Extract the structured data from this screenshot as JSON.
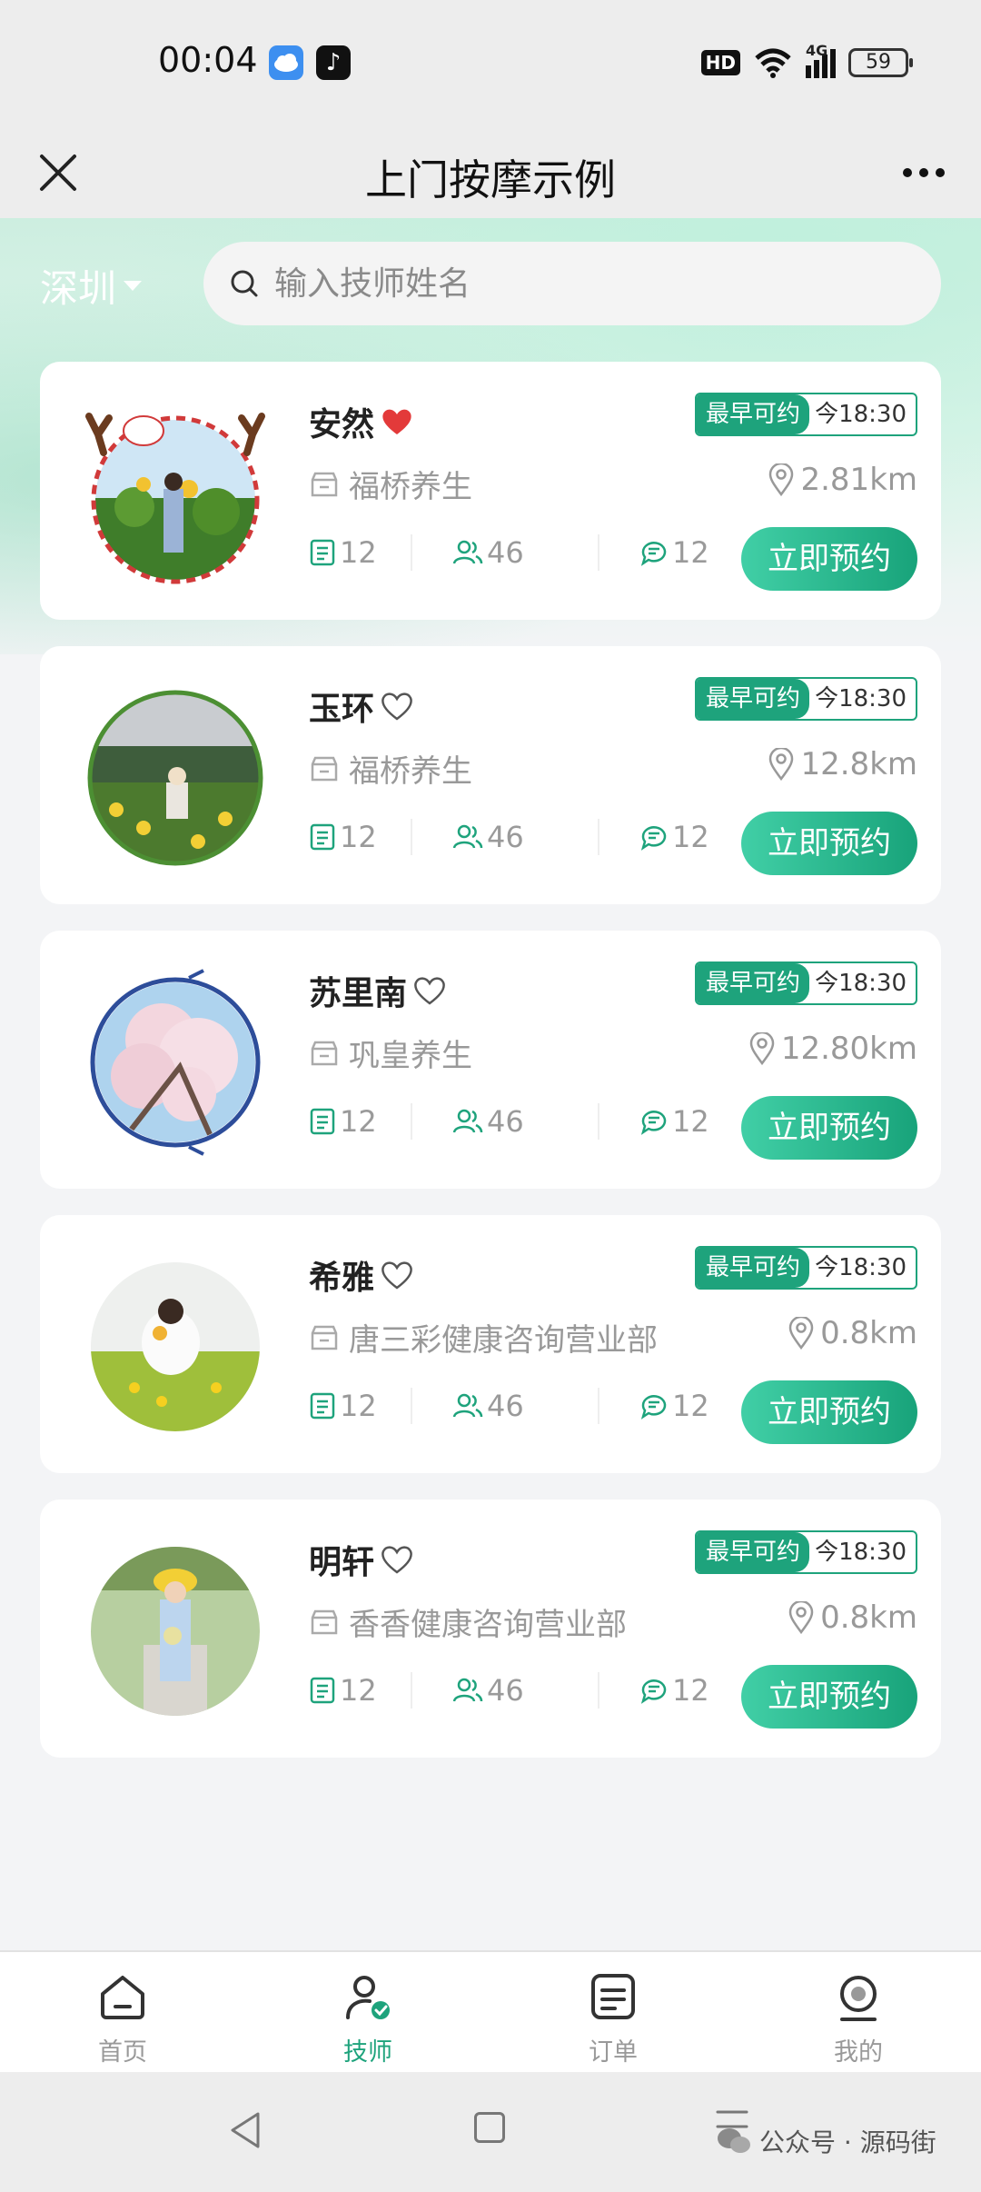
{
  "status_bar": {
    "time": "00:04",
    "tiktok_glyph": "♪",
    "hd": "HD",
    "network": "4G",
    "battery": "59"
  },
  "header": {
    "title": "上门按摩示例"
  },
  "filter": {
    "city": "深圳",
    "search_placeholder": "输入技师姓名"
  },
  "colors": {
    "accent": "#1ea37c",
    "favorite_red": "#e33a3a"
  },
  "therapists": [
    {
      "name": "安然",
      "favorited": true,
      "earliest_label": "最早可约",
      "earliest_time": "今18:30",
      "shop": "福桥养生",
      "distance": "2.81km",
      "orders": "12",
      "clients": "46",
      "reviews": "12",
      "book_label": "立即预约"
    },
    {
      "name": "玉环",
      "favorited": false,
      "earliest_label": "最早可约",
      "earliest_time": "今18:30",
      "shop": "福桥养生",
      "distance": "12.8km",
      "orders": "12",
      "clients": "46",
      "reviews": "12",
      "book_label": "立即预约"
    },
    {
      "name": "苏里南",
      "favorited": false,
      "earliest_label": "最早可约",
      "earliest_time": "今18:30",
      "shop": "巩皇养生",
      "distance": "12.80km",
      "orders": "12",
      "clients": "46",
      "reviews": "12",
      "book_label": "立即预约"
    },
    {
      "name": "希雅",
      "favorited": false,
      "earliest_label": "最早可约",
      "earliest_time": "今18:30",
      "shop": "唐三彩健康咨询营业部",
      "distance": "0.8km",
      "orders": "12",
      "clients": "46",
      "reviews": "12",
      "book_label": "立即预约"
    },
    {
      "name": "明轩",
      "favorited": false,
      "earliest_label": "最早可约",
      "earliest_time": "今18:30",
      "shop": "香香健康咨询营业部",
      "distance": "0.8km",
      "orders": "12",
      "clients": "46",
      "reviews": "12",
      "book_label": "立即预约"
    }
  ],
  "tabs": [
    {
      "label": "首页",
      "icon": "home-icon",
      "active": false
    },
    {
      "label": "技师",
      "icon": "therapist-icon",
      "active": true
    },
    {
      "label": "订单",
      "icon": "order-icon",
      "active": false
    },
    {
      "label": "我的",
      "icon": "profile-icon",
      "active": false
    }
  ],
  "watermark": "公众号 · 源码街"
}
